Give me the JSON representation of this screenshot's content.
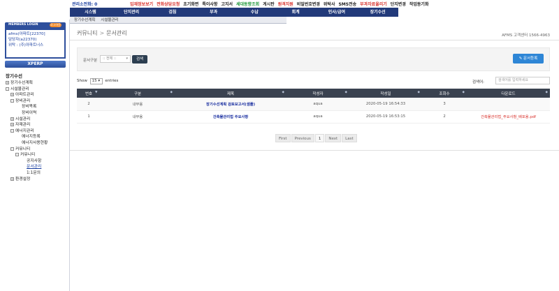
{
  "topbar": {
    "counter": "관리소전화: 0",
    "links": [
      {
        "label": "입재정보보기",
        "color": "#d9302a"
      },
      {
        "label": "전화상담요청",
        "color": "#d9302a"
      },
      {
        "label": "초기화면",
        "color": "#222"
      },
      {
        "label": "특이사항",
        "color": "#222"
      },
      {
        "label": "고지서",
        "color": "#222"
      },
      {
        "label": "세대동향조회",
        "color": "#1f9a3a"
      },
      {
        "label": "게시판",
        "color": "#222"
      },
      {
        "label": "원격지원",
        "color": "#d9302a"
      },
      {
        "label": "비밀번호변경",
        "color": "#222"
      },
      {
        "label": "위탁사",
        "color": "#222"
      },
      {
        "label": "SMS전송",
        "color": "#222"
      },
      {
        "label": "부과자료올리기",
        "color": "#d9302a"
      },
      {
        "label": "단지변경",
        "color": "#222"
      },
      {
        "label": "작업동기화",
        "color": "#222"
      }
    ]
  },
  "mainnav": [
    "시스템",
    "단지관리",
    "검침",
    "부과",
    "수납",
    "회계",
    "인사/급여",
    "장기수선"
  ],
  "subnav": [
    "장기수선계획",
    "시설물관리"
  ],
  "login": {
    "tab_label": "MEMBERS LOGIN",
    "button_label": "로그아웃",
    "line1": "afms(아파트[22370]",
    "line2": "담당자(a22370)",
    "line3": "위탁 : (주)아파트너스"
  },
  "xperp_label": "XPERP",
  "tree": {
    "root": "장기수선",
    "nodes": [
      {
        "label": "장기수선계획",
        "indent": 1,
        "pm": "+"
      },
      {
        "label": "시설물관리",
        "indent": 1,
        "pm": "-"
      },
      {
        "label": "아파트관리",
        "indent": 2,
        "pm": "+"
      },
      {
        "label": "장비관리",
        "indent": 2,
        "pm": "-"
      },
      {
        "label": "장비목록",
        "indent": 3,
        "pm": ""
      },
      {
        "label": "장비이력",
        "indent": 3,
        "pm": ""
      },
      {
        "label": "시설관리",
        "indent": 2,
        "pm": "+"
      },
      {
        "label": "자재관리",
        "indent": 2,
        "pm": "+"
      },
      {
        "label": "에너지관리",
        "indent": 2,
        "pm": "-"
      },
      {
        "label": "에너지등록",
        "indent": 3,
        "pm": ""
      },
      {
        "label": "에너지사용현황",
        "indent": 3,
        "pm": ""
      },
      {
        "label": "커뮤니티",
        "indent": 2,
        "pm": "-"
      },
      {
        "label": "커뮤니티",
        "indent": 3,
        "pm": "-"
      },
      {
        "label": "공지사항",
        "indent": 4,
        "pm": ""
      },
      {
        "label": "문서관리",
        "indent": 4,
        "pm": "",
        "active": true
      },
      {
        "label": "1:1문의",
        "indent": 4,
        "pm": ""
      },
      {
        "label": "환경설정",
        "indent": 2,
        "pm": "+"
      }
    ]
  },
  "breadcrumb": {
    "parent": "커뮤니티",
    "sep": ">",
    "current": "문서관리"
  },
  "contact": "AFMS 고객센터 1566-4963",
  "search": {
    "label": "문서구분",
    "select_value": ":: 전체 ::",
    "button": "검색",
    "register_button": "문서등록"
  },
  "table_controls": {
    "show_label": "Show",
    "show_value": "15",
    "entries_label": "entries",
    "find_label": "검색어:",
    "find_placeholder": "검색어를 입력하세요"
  },
  "table": {
    "headers": [
      "번호",
      "구분",
      "제목",
      "작성자",
      "작성일",
      "조회수",
      "다운로드"
    ],
    "rows": [
      [
        "2",
        "내부용",
        "장기수선계획 검토보고서(샘플)",
        "aqua",
        "2020-05-19 16:54:33",
        "3",
        ""
      ],
      [
        "1",
        "내부용",
        "건축물관리법 주요사항",
        "aqua",
        "2020-05-19 16:53:15",
        "2",
        "건축물관리법_주요사항_배포용.pdf"
      ]
    ]
  },
  "pager": [
    "First",
    "Previous",
    "1",
    "Next",
    "Last"
  ]
}
